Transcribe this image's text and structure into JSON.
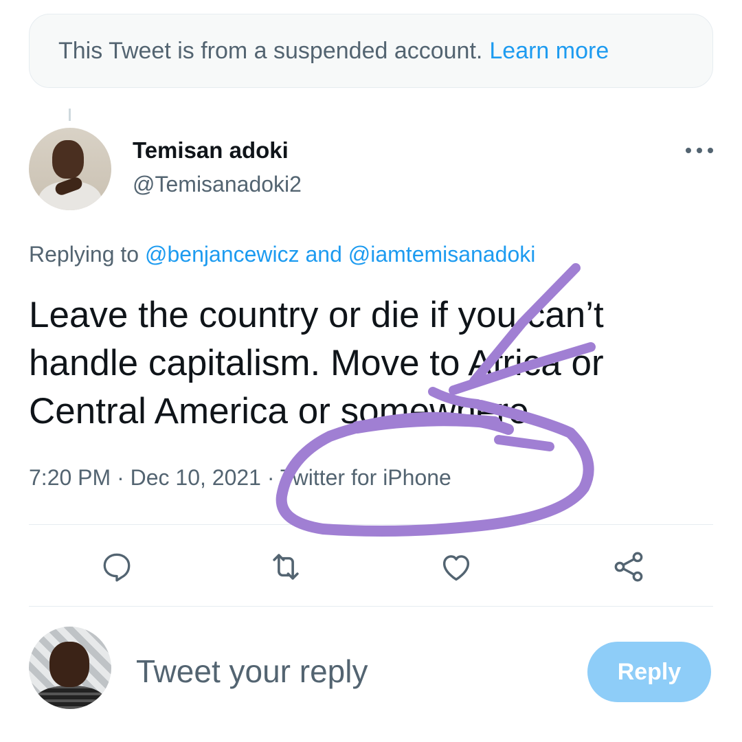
{
  "notice": {
    "text": "This Tweet is from a suspended account.",
    "link": "Learn more"
  },
  "tweet": {
    "author_name": "Temisan adoki",
    "author_handle": "@Temisanadoki2",
    "replying_prefix": "Replying to",
    "mention_1": "@benjancewicz",
    "conjunction": "and",
    "mention_2": "@iamtemisanadoki",
    "text": "Leave the country or die if you can’t handle capitalism. Move to Africa or Central America or somewhere.",
    "time": "7:20 PM",
    "separator": "·",
    "date": "Dec 10, 2021",
    "source": "Twitter for iPhone"
  },
  "actions": {
    "icons": [
      "reply-icon",
      "retweet-icon",
      "like-icon",
      "share-icon"
    ]
  },
  "compose": {
    "placeholder": "Tweet your reply",
    "button_label": "Reply"
  },
  "colors": {
    "accent": "#1d9bf0",
    "secondary_text": "#536471",
    "reply_button_disabled": "#8ecdf8",
    "annotation": "#a07fd3"
  }
}
